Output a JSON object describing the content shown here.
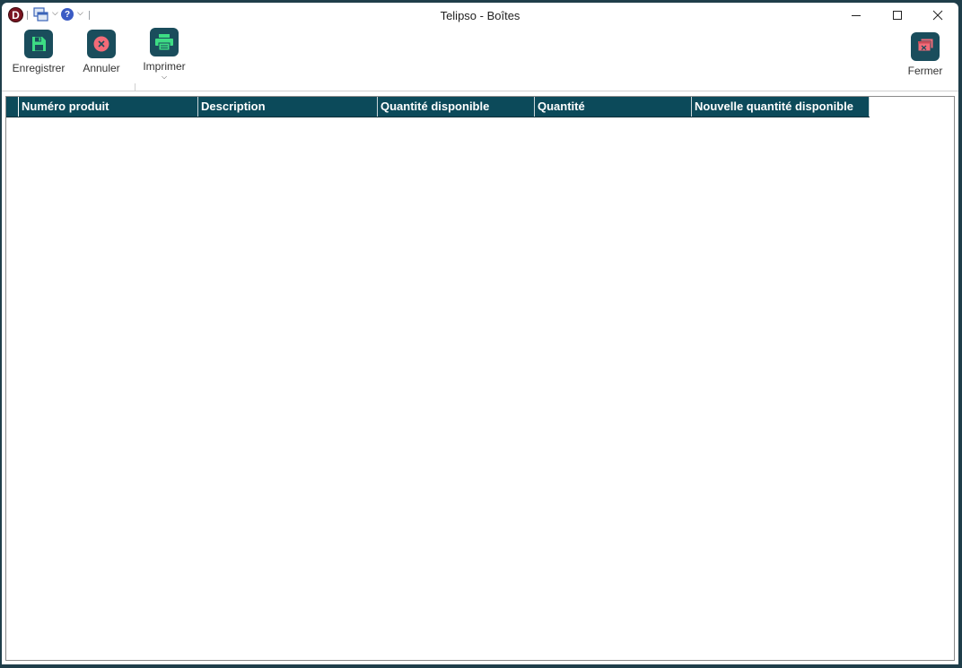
{
  "window": {
    "title": "Telipso - Boîtes",
    "logo_letter": "D",
    "help_glyph": "?"
  },
  "icons": {
    "app": "app-logo-icon",
    "windows": "windows-list-icon",
    "help": "help-icon",
    "minimize": "minimize-icon",
    "maximize": "maximize-icon",
    "close": "close-icon",
    "save": "save-icon",
    "cancel": "cancel-icon",
    "print": "printer-icon",
    "close_form": "close-form-icon"
  },
  "ribbon": {
    "save_label": "Enregistrer",
    "cancel_label": "Annuler",
    "print_label": "Imprimer",
    "close_label": "Fermer"
  },
  "grid": {
    "columns": [
      "Numéro produit",
      "Description",
      "Quantité disponible",
      "Quantité",
      "Nouvelle quantité disponible"
    ],
    "rows": []
  },
  "colors": {
    "header_bg": "#0c4a5a",
    "accent_green": "#3ddc84",
    "accent_red": "#f26b78",
    "frame": "#1f3e4a"
  }
}
